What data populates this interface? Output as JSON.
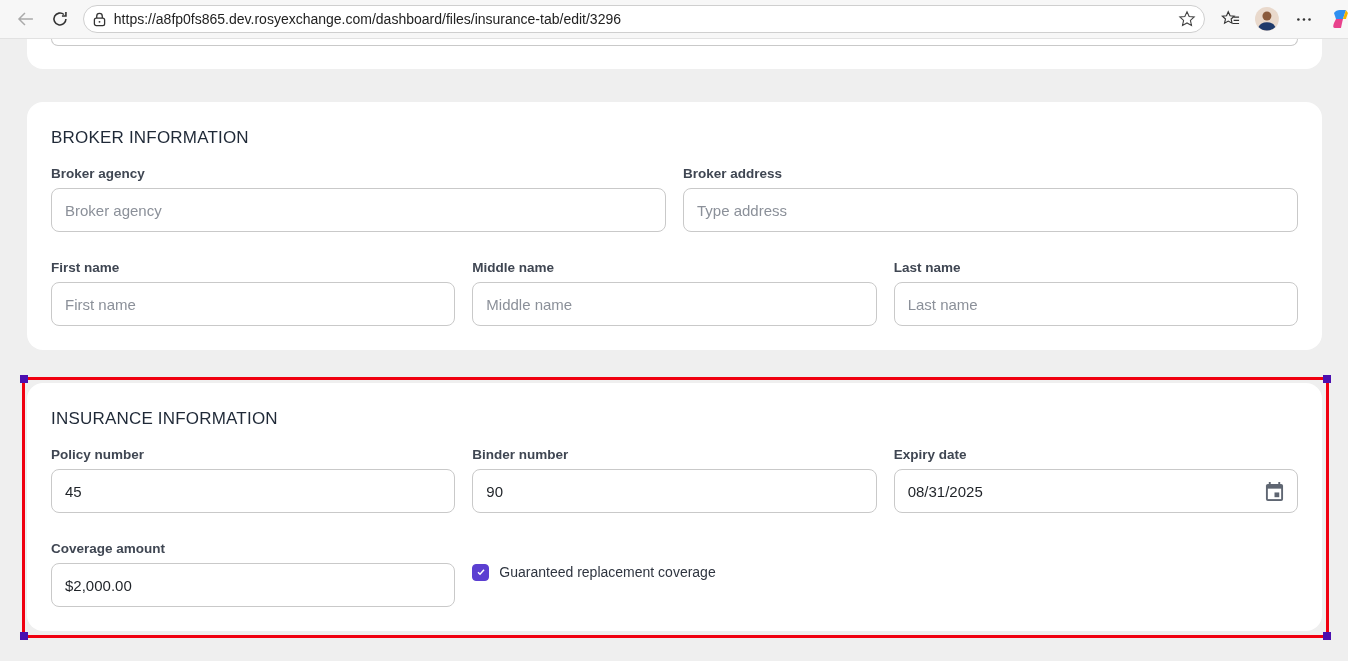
{
  "browser": {
    "url": "https://a8fp0fs865.dev.rosyexchange.com/dashboard/files/insurance-tab/edit/3296",
    "back_disabled": true
  },
  "sections": [
    {
      "title": "BROKER INFORMATION",
      "selected": false,
      "rows": [
        [
          {
            "kind": "text",
            "label": "Broker agency",
            "placeholder": "Broker agency"
          },
          {
            "kind": "text",
            "label": "Broker address",
            "placeholder": "Type address"
          }
        ],
        [
          {
            "kind": "text",
            "label": "First name",
            "placeholder": "First name"
          },
          {
            "kind": "text",
            "label": "Middle name",
            "placeholder": "Middle name"
          },
          {
            "kind": "text",
            "label": "Last name",
            "placeholder": "Last name"
          }
        ]
      ]
    },
    {
      "title": "INSURANCE INFORMATION",
      "selected": true,
      "rows": [
        [
          {
            "kind": "text",
            "label": "Policy number",
            "value": "45"
          },
          {
            "kind": "text",
            "label": "Binder number",
            "value": "90"
          },
          {
            "kind": "date",
            "label": "Expiry date",
            "value": "08/31/2025"
          }
        ],
        [
          {
            "kind": "text",
            "label": "Coverage amount",
            "value": "$2,000.00"
          },
          {
            "kind": "checkbox",
            "label": "Guaranteed replacement coverage",
            "checked": true
          }
        ]
      ]
    }
  ]
}
